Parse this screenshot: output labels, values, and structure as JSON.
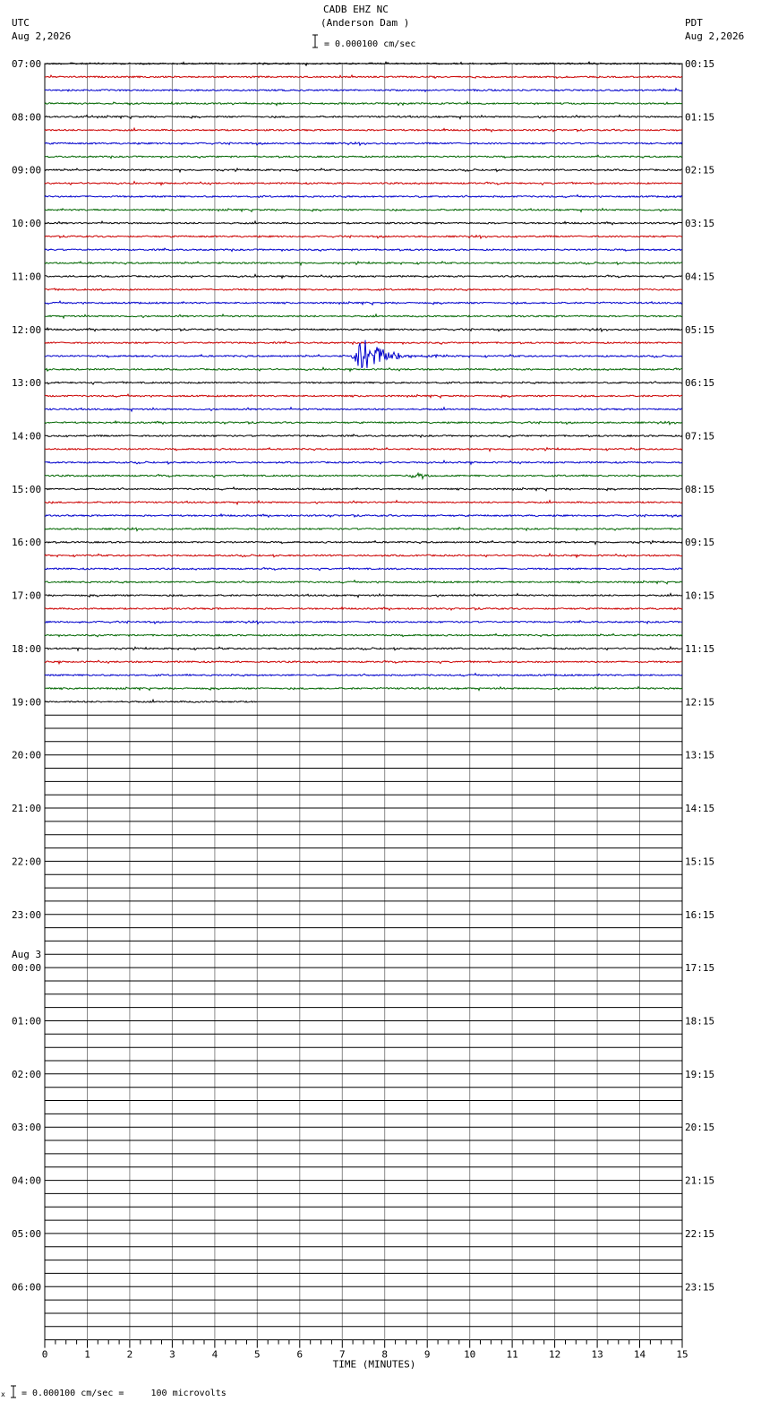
{
  "header": {
    "station": "CADB EHZ NC",
    "location": "(Anderson Dam )",
    "scale_text": "= 0.000100 cm/sec",
    "left_zone": "UTC",
    "left_date": "Aug 2,2026",
    "right_zone": "PDT",
    "right_date": "Aug 2,2026"
  },
  "footer": {
    "prefix": "x",
    "calibration": "= 0.000100 cm/sec =     100 microvolts"
  },
  "colors": {
    "trace_cycle": [
      "#000000",
      "#cc0000",
      "#0000cc",
      "#006600"
    ],
    "grid": "#000000"
  },
  "chart_data": {
    "type": "line",
    "xlabel": "TIME (MINUTES)",
    "xlim": [
      0,
      15
    ],
    "x_ticks": [
      "0",
      "1",
      "2",
      "3",
      "4",
      "5",
      "6",
      "7",
      "8",
      "9",
      "10",
      "11",
      "12",
      "13",
      "14",
      "15"
    ],
    "rows_total": 96,
    "rows_per_hour": 4,
    "rows_recorded": 49,
    "last_row_minutes": 5,
    "left_hour_labels": [
      "07:00",
      "08:00",
      "09:00",
      "10:00",
      "11:00",
      "12:00",
      "13:00",
      "14:00",
      "15:00",
      "16:00",
      "17:00",
      "18:00",
      "19:00",
      "20:00",
      "21:00",
      "22:00",
      "23:00",
      "00:00",
      "01:00",
      "02:00",
      "03:00",
      "04:00",
      "05:00",
      "06:00"
    ],
    "date_change_label": "Aug 3",
    "date_change_hour_index": 17,
    "right_hour_labels": [
      "00:15",
      "01:15",
      "02:15",
      "03:15",
      "04:15",
      "05:15",
      "06:15",
      "07:15",
      "08:15",
      "09:15",
      "10:15",
      "11:15",
      "12:15",
      "13:15",
      "14:15",
      "15:15",
      "16:15",
      "17:15",
      "18:15",
      "19:15",
      "20:15",
      "21:15",
      "22:15",
      "23:15"
    ],
    "events": [
      {
        "row": 22,
        "start_min": 7.2,
        "end_min": 9.7,
        "peak_min": 7.5,
        "amplitude": 1.0
      },
      {
        "row": 31,
        "start_min": 8.4,
        "end_min": 9.1,
        "peak_min": 8.8,
        "amplitude": 0.12
      }
    ]
  }
}
